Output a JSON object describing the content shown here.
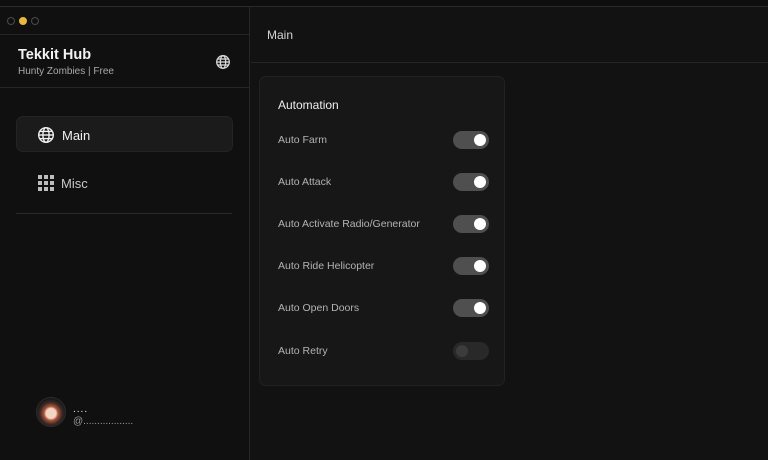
{
  "app": {
    "title": "Tekkit Hub",
    "subtitle": "Hunty Zombies | Free"
  },
  "sidebar": {
    "items": [
      {
        "label": "Main",
        "icon": "globe-icon",
        "active": true
      },
      {
        "label": "Misc",
        "icon": "grid-icon",
        "active": false
      }
    ]
  },
  "user": {
    "name": "....",
    "handle": "@.................."
  },
  "header": {
    "title": "Main"
  },
  "section": {
    "title": "Automation",
    "toggles": [
      {
        "label": "Auto Farm",
        "on": true
      },
      {
        "label": "Auto Attack",
        "on": true
      },
      {
        "label": "Auto Activate Radio/Generator",
        "on": true
      },
      {
        "label": "Auto Ride Helicopter",
        "on": true
      },
      {
        "label": "Auto Open Doors",
        "on": true
      },
      {
        "label": "Auto Retry",
        "on": false
      }
    ]
  },
  "colors": {
    "background": "#121212",
    "accent_dot": "#e6b93c",
    "toggle_on_track": "#4f4f4f",
    "toggle_off_track": "#292929"
  }
}
